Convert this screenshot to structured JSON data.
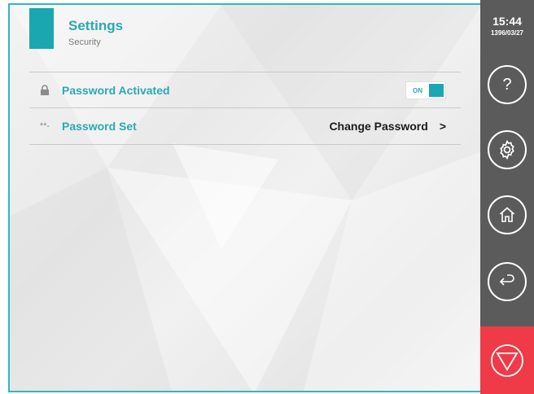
{
  "header": {
    "title": "Settings",
    "subtitle": "Security"
  },
  "rows": [
    {
      "icon": "lock-icon",
      "label": "Password Activated",
      "toggle_text": "ON",
      "toggle_on": true
    },
    {
      "icon": "asterisks-icon",
      "icon_text": "**-",
      "label": "Password Set",
      "action_label": "Change Password",
      "action_chevron": ">"
    }
  ],
  "sidebar": {
    "time": "15:44",
    "date": "1396/03/27",
    "help_glyph": "?",
    "buttons": [
      "help-icon",
      "gear-icon",
      "home-icon",
      "back-icon",
      "stop-icon"
    ]
  },
  "colors": {
    "accent": "#1aa7b0",
    "sidebar": "#5b5b5b",
    "stop": "#ef3b47"
  }
}
